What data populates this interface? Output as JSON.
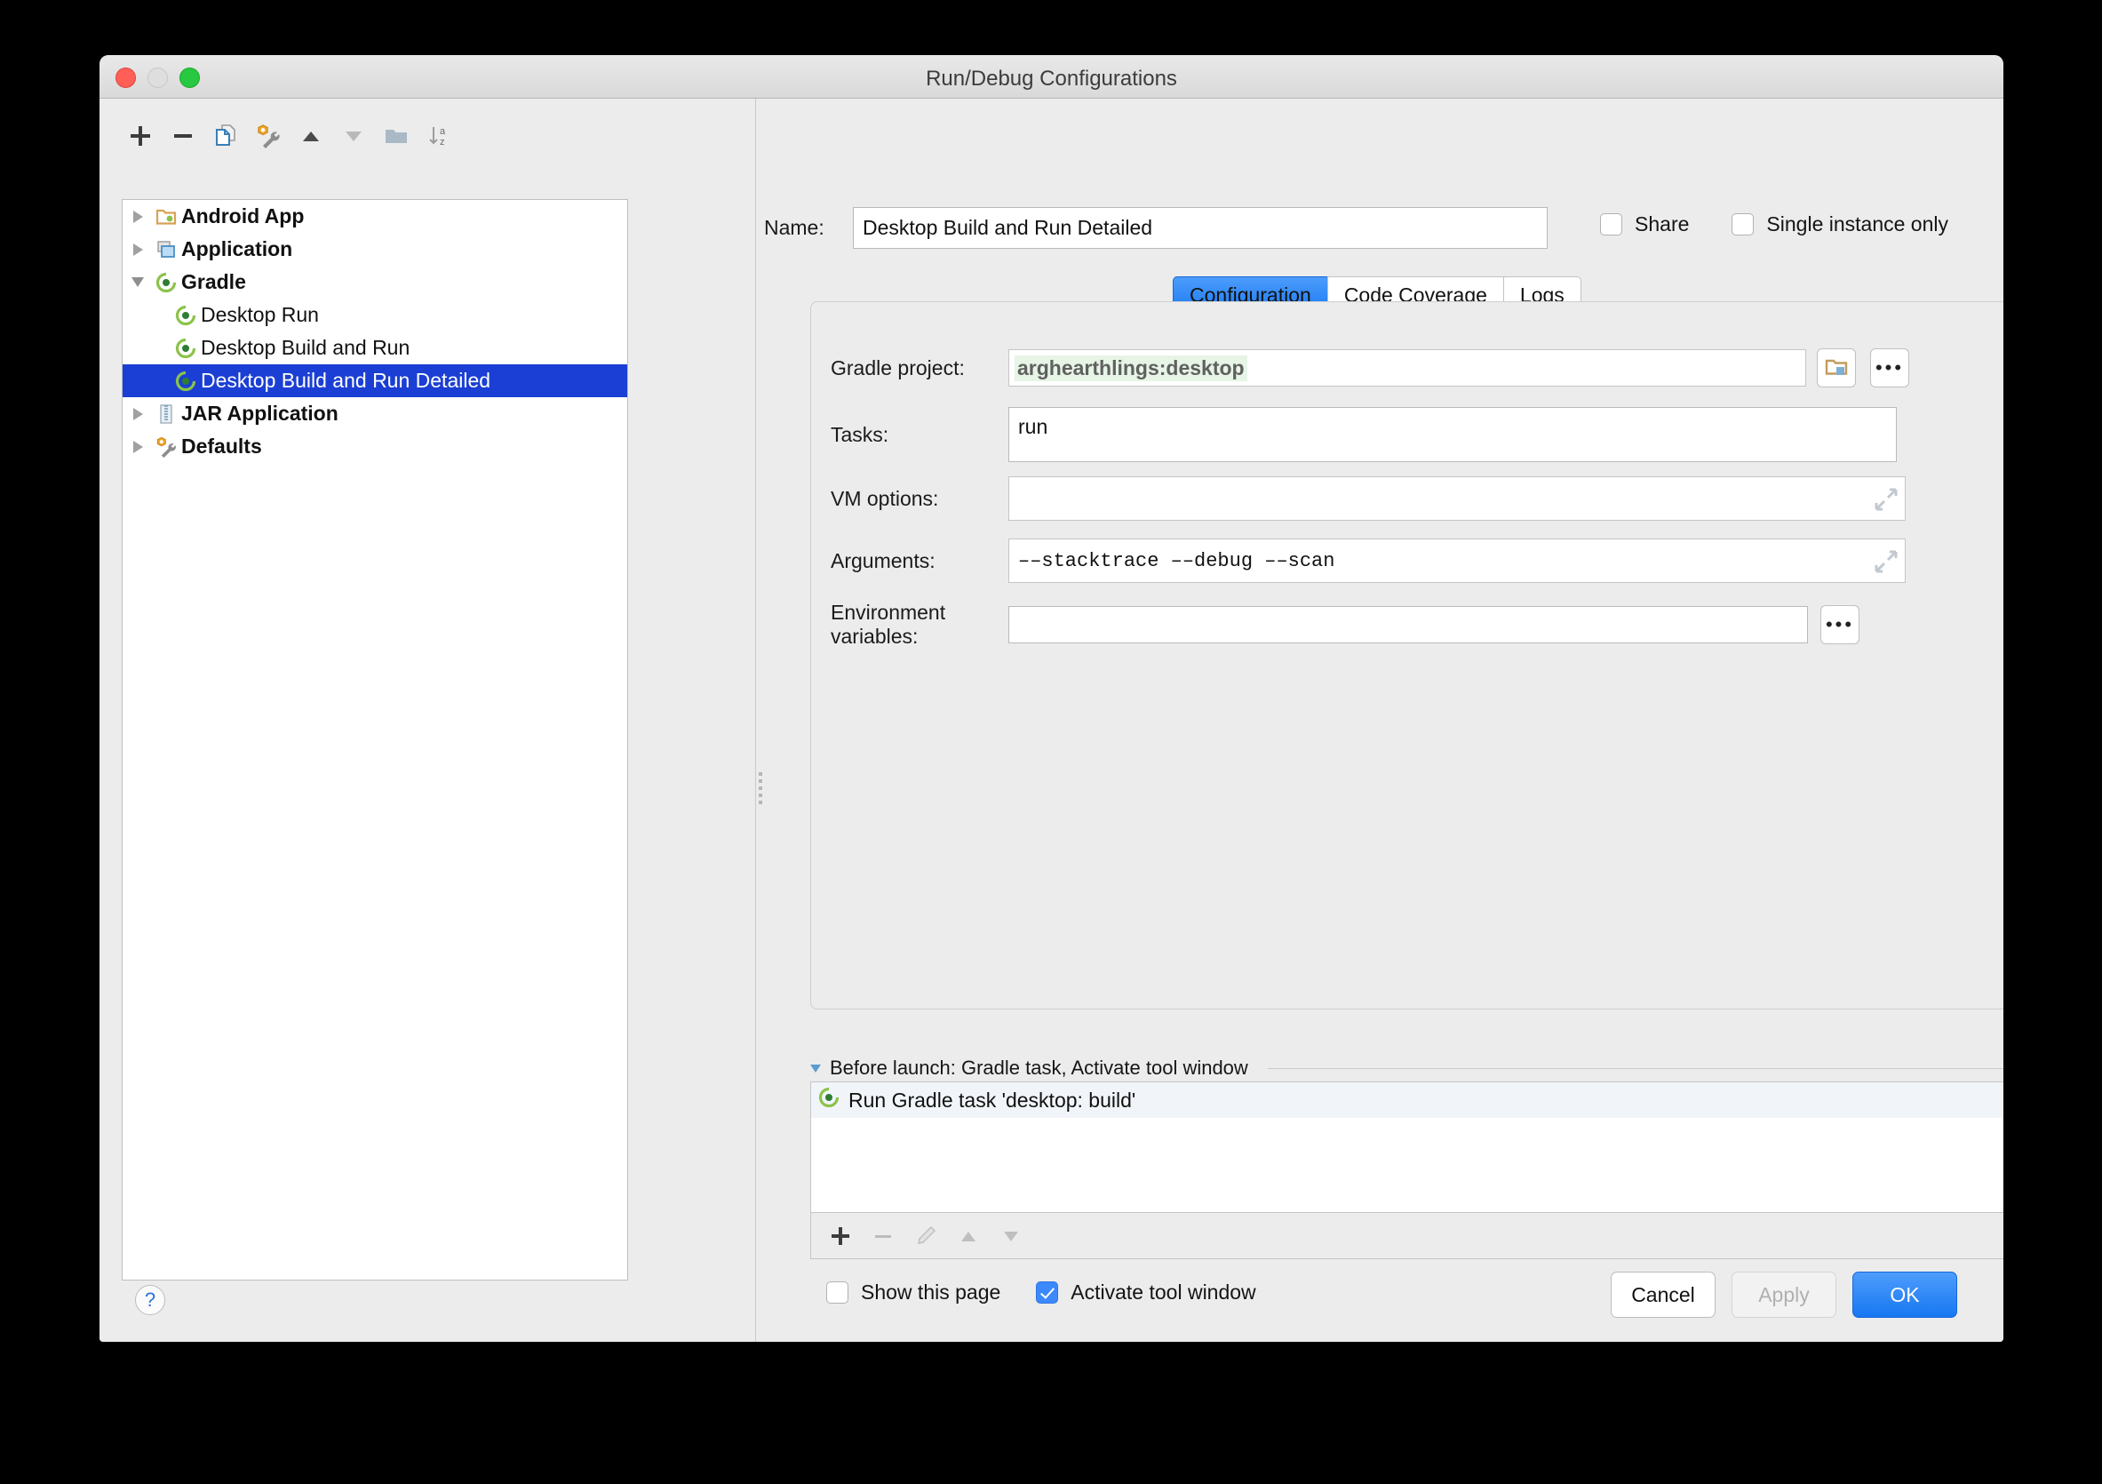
{
  "window": {
    "title": "Run/Debug Configurations",
    "traffic_lights": [
      "close",
      "minimize",
      "zoom"
    ]
  },
  "left_pane": {
    "toolbar": [
      {
        "name": "add",
        "icon": "plus-icon",
        "enabled": true
      },
      {
        "name": "remove",
        "icon": "minus-icon",
        "enabled": true
      },
      {
        "name": "copy",
        "icon": "copy-icon",
        "enabled": true
      },
      {
        "name": "edit-defaults",
        "icon": "wrench-icon",
        "enabled": true
      },
      {
        "name": "move-up",
        "icon": "triangle-up-icon",
        "enabled": true
      },
      {
        "name": "move-down",
        "icon": "triangle-down-icon",
        "enabled": false
      },
      {
        "name": "new-folder",
        "icon": "folder-icon",
        "enabled": true
      },
      {
        "name": "sort-alphabetically",
        "icon": "sort-az-icon",
        "enabled": true
      }
    ],
    "tree": [
      {
        "label": "Android App",
        "icon": "android-folder-icon",
        "level": 0,
        "twisty": "right",
        "bold": true,
        "selected": false
      },
      {
        "label": "Application",
        "icon": "application-icon",
        "level": 0,
        "twisty": "right",
        "bold": true,
        "selected": false
      },
      {
        "label": "Gradle",
        "icon": "gradle-icon",
        "level": 0,
        "twisty": "down",
        "bold": true,
        "selected": false
      },
      {
        "label": "Desktop Run",
        "icon": "gradle-icon",
        "level": 1,
        "twisty": "none",
        "bold": false,
        "selected": false
      },
      {
        "label": "Desktop Build and Run",
        "icon": "gradle-icon",
        "level": 1,
        "twisty": "none",
        "bold": false,
        "selected": false
      },
      {
        "label": "Desktop Build and Run Detailed",
        "icon": "gradle-icon",
        "level": 1,
        "twisty": "none",
        "bold": false,
        "selected": true
      },
      {
        "label": "JAR Application",
        "icon": "jar-icon",
        "level": 0,
        "twisty": "right",
        "bold": true,
        "selected": false
      },
      {
        "label": "Defaults",
        "icon": "wrench-icon",
        "level": 0,
        "twisty": "right",
        "bold": true,
        "selected": false
      }
    ]
  },
  "right_pane": {
    "name_label": "Name:",
    "name_value": "Desktop Build and Run Detailed",
    "share": {
      "label": "Share",
      "checked": false
    },
    "single_instance": {
      "label": "Single instance only",
      "checked": false
    },
    "tabs": [
      {
        "label": "Configuration",
        "active": true
      },
      {
        "label": "Code Coverage",
        "active": false
      },
      {
        "label": "Logs",
        "active": false
      }
    ],
    "fields": {
      "gradle_project_label": "Gradle project:",
      "gradle_project_value": "arghearthlings:desktop",
      "tasks_label": "Tasks:",
      "tasks_value": "run",
      "vm_options_label": "VM options:",
      "vm_options_value": "",
      "arguments_label": "Arguments:",
      "arguments_value": "––stacktrace ––debug ––scan",
      "env_label": "Environment variables:",
      "env_value": ""
    },
    "before_launch": {
      "title": "Before launch: Gradle task, Activate tool window",
      "items": [
        {
          "label": "Run Gradle task 'desktop: build'",
          "icon": "gradle-icon"
        }
      ],
      "toolbar": [
        {
          "name": "add",
          "icon": "plus-icon",
          "enabled": true
        },
        {
          "name": "remove",
          "icon": "minus-icon",
          "enabled": false
        },
        {
          "name": "edit",
          "icon": "pencil-icon",
          "enabled": false
        },
        {
          "name": "move-up",
          "icon": "triangle-up-icon",
          "enabled": false
        },
        {
          "name": "move-down",
          "icon": "triangle-down-icon",
          "enabled": false
        }
      ],
      "show_this_page": {
        "label": "Show this page",
        "checked": false
      },
      "activate_tool_window": {
        "label": "Activate tool window",
        "checked": true
      }
    }
  },
  "footer": {
    "help_glyph": "?",
    "cancel_label": "Cancel",
    "apply_label": "Apply",
    "apply_enabled": false,
    "ok_label": "OK"
  },
  "colors": {
    "selection_blue": "#1b3fd4",
    "accent_blue": "#1877f2",
    "green_highlight": "#e6f5e6",
    "gradle_green": "#4caf50",
    "window_bg": "#ececec"
  }
}
